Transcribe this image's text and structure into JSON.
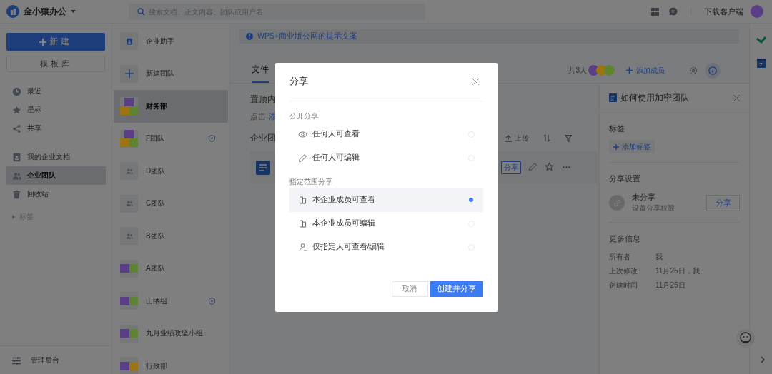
{
  "app": {
    "name": "金小猿办公"
  },
  "search": {
    "placeholder": "搜索文档、正文内容、团队或用户名"
  },
  "download_link": "下载客户端",
  "user_avatar": {
    "color": "#5b3f86"
  },
  "sidebar": {
    "new_button": "新建",
    "template_button": "模板库",
    "groups": [
      [
        {
          "label": "最近",
          "selected": false
        },
        {
          "label": "星标",
          "selected": false
        },
        {
          "label": "共享",
          "selected": false
        }
      ],
      [
        {
          "label": "我的企业文档",
          "selected": false
        },
        {
          "label": "企业团队",
          "selected": true
        },
        {
          "label": "回收站",
          "selected": false
        }
      ]
    ],
    "tags": {
      "label": "标签",
      "expanded": false
    },
    "admin": "管理后台"
  },
  "teams": [
    {
      "name": "企业助手",
      "kind": "assistant",
      "selected": false,
      "protected": false
    },
    {
      "name": "新建团队",
      "kind": "add",
      "selected": false,
      "protected": false
    },
    {
      "name": "财务部",
      "kind": "mosaic",
      "tiles": [
        {
          "color": "#5b3f86"
        },
        {
          "color": "#9c7414"
        },
        {
          "color": "#5e8432"
        }
      ],
      "selected": true,
      "protected": false
    },
    {
      "name": "F团队",
      "kind": "mosaic",
      "tiles": [
        {
          "color": "#5b3f86"
        },
        {
          "color": "#9c7414"
        },
        {
          "color": "#5e8432"
        }
      ],
      "selected": false,
      "protected": true
    },
    {
      "name": "D团队",
      "kind": "people",
      "selected": false,
      "protected": false
    },
    {
      "name": "C团队",
      "kind": "people",
      "selected": false,
      "protected": false
    },
    {
      "name": "B团队",
      "kind": "people",
      "selected": false,
      "protected": false
    },
    {
      "name": "A团队",
      "kind": "mosaic",
      "tiles": [
        {
          "color": "#5b3f86"
        },
        {
          "color": "#5e8432"
        }
      ],
      "selected": false,
      "protected": false
    },
    {
      "name": "山纳组",
      "kind": "mosaic",
      "tiles": [
        {
          "color": "#5b3f86"
        },
        {
          "color": "#5e8432"
        }
      ],
      "selected": false,
      "protected": true
    },
    {
      "name": "九月业绩攻坚小组",
      "kind": "mosaic",
      "tiles": [
        {
          "color": "#5b3f86"
        },
        {
          "color": "#5e8432"
        }
      ],
      "selected": false,
      "protected": false
    },
    {
      "name": "行政部",
      "kind": "mosaic",
      "tiles": [
        {
          "color": "#5b3f86"
        },
        {
          "color": "#9c7414"
        }
      ],
      "selected": false,
      "protected": false
    }
  ],
  "banner": "WPS+商业版公网的提示文案",
  "tabs": [
    {
      "label": "文件",
      "selected": true
    }
  ],
  "members": {
    "count": "共3人",
    "avatars": [
      {
        "color": "#5b3f86"
      },
      {
        "color": "#9c7414"
      },
      {
        "color": "#5e8432"
      }
    ],
    "add": "添加成员"
  },
  "content": {
    "pinned_title": "置顶内",
    "pinned_hint": "点击",
    "pinned_link": "添",
    "section_title": "企业团",
    "upload": "上传",
    "file_tag": "分享"
  },
  "details": {
    "title": "如何使用加密团队",
    "tags_title": "标签",
    "add_tag": "添加标签",
    "share_title": "分享设置",
    "share_status": "未分享",
    "share_hint": "设置分享权限",
    "share_button": "分享",
    "info_title": "更多信息",
    "info": [
      {
        "label": "所有者",
        "value": "我"
      },
      {
        "label": "上次修改",
        "value": "11月25日，我"
      },
      {
        "label": "创建时间",
        "value": "11月25日"
      }
    ]
  },
  "calendar_day": "7",
  "dialog": {
    "title": "分享",
    "sections": [
      {
        "title": "公开分享",
        "options": [
          {
            "label": "任何人可查看",
            "selected": false
          },
          {
            "label": "任何人可编辑",
            "selected": false
          }
        ]
      },
      {
        "title": "指定范围分享",
        "options": [
          {
            "label": "本企业成员可查看",
            "selected": true
          },
          {
            "label": "本企业成员可编辑",
            "selected": false
          },
          {
            "label": "仅指定人可查看/编辑",
            "selected": false
          }
        ]
      }
    ],
    "cancel": "取消",
    "confirm": "创建并分享"
  }
}
